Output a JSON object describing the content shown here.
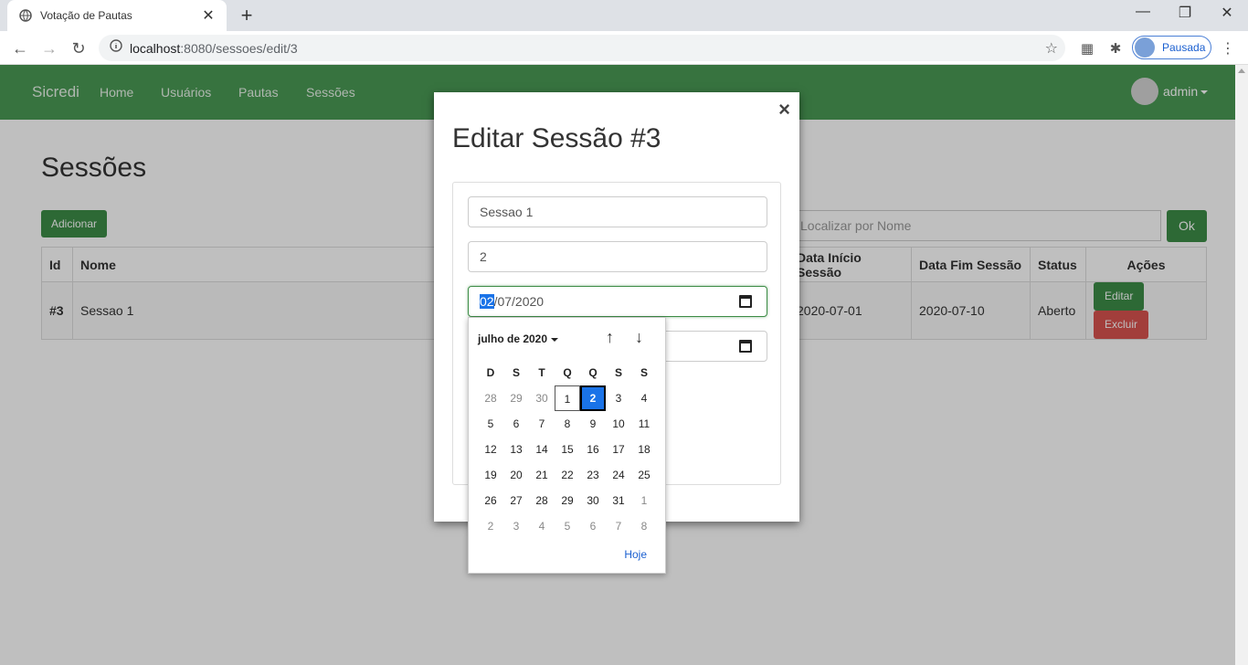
{
  "browser": {
    "tab_title": "Votação de Pautas",
    "url_host": "localhost",
    "url_path": ":8080/sessoes/edit/3",
    "profile_label": "Pausada"
  },
  "navbar": {
    "brand": "Sicredi",
    "links": [
      "Home",
      "Usuários",
      "Pautas",
      "Sessões"
    ],
    "user": "admin"
  },
  "page": {
    "title": "Sessões",
    "add_label": "Adicionar",
    "search_placeholder": "Localizar por Nome",
    "ok_label": "Ok"
  },
  "table": {
    "headers": [
      "Id",
      "Nome",
      "Data Início Sessão",
      "Data Fim Sessão",
      "Status",
      "Ações"
    ],
    "rows": [
      {
        "id": "#3",
        "nome": "Sessao 1",
        "inicio": "2020-07-01",
        "fim": "2020-07-10",
        "status": "Aberto",
        "edit": "Editar",
        "delete": "Excluir"
      }
    ]
  },
  "modal": {
    "title": "Editar Sessão #3",
    "close": "×",
    "field_nome": "Sessao 1",
    "field_pauta": "2",
    "date_day": "02",
    "date_rest": "/07/2020"
  },
  "picker": {
    "month_label": "julho de 2020",
    "weekdays": [
      "D",
      "S",
      "T",
      "Q",
      "Q",
      "S",
      "S"
    ],
    "weeks": [
      [
        "28",
        "29",
        "30",
        "1",
        "2",
        "3",
        "4"
      ],
      [
        "5",
        "6",
        "7",
        "8",
        "9",
        "10",
        "11"
      ],
      [
        "12",
        "13",
        "14",
        "15",
        "16",
        "17",
        "18"
      ],
      [
        "19",
        "20",
        "21",
        "22",
        "23",
        "24",
        "25"
      ],
      [
        "26",
        "27",
        "28",
        "29",
        "30",
        "31",
        "1"
      ],
      [
        "2",
        "3",
        "4",
        "5",
        "6",
        "7",
        "8"
      ]
    ],
    "today_label": "Hoje"
  }
}
